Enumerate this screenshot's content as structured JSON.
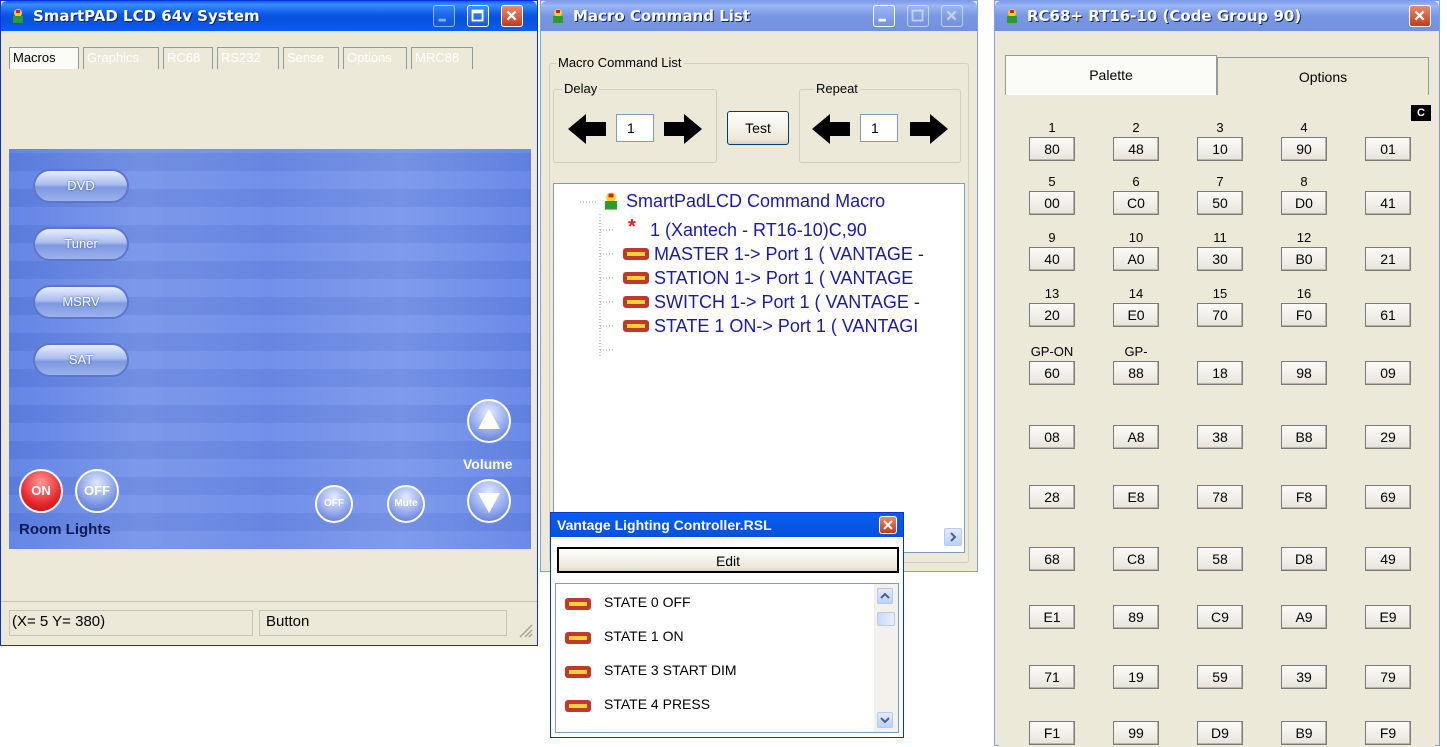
{
  "smartpad": {
    "title": "SmartPAD LCD 64v System",
    "tabs": [
      "Macros",
      "Graphics",
      "RC68",
      "RS232",
      "Sense",
      "Options",
      "MRC88"
    ],
    "buttons": [
      "DVD",
      "Tuner",
      "MSRV",
      "SAT"
    ],
    "lights_on": "ON",
    "lights_off": "OFF",
    "room_lights_label": "Room Lights",
    "volume_label": "Volume",
    "off_small": "OFF",
    "mute_small": "Mute",
    "status_coords": "(X= 5 Y= 380)",
    "status_type": "Button"
  },
  "macro": {
    "title": "Macro Command List",
    "group_label": "Macro Command List",
    "delay_label": "Delay",
    "delay_value": "1",
    "test_label": "Test",
    "repeat_label": "Repeat",
    "repeat_value": "1",
    "tree_root": "SmartPadLCD Command Macro",
    "tree_items": [
      "1 (Xantech - RT16-10)C,90",
      "MASTER 1-> Port 1 ( VANTAGE -",
      "STATION 1-> Port 1 ( VANTAGE",
      "SWITCH 1-> Port 1 ( VANTAGE -",
      "STATE 1 ON-> Port 1 ( VANTAGI"
    ]
  },
  "vantage": {
    "title": "Vantage Lighting Controller.RSL",
    "edit_label": "Edit",
    "items": [
      "STATE 0 OFF",
      "STATE 1 ON",
      "STATE 3 START DIM",
      "STATE 4 PRESS"
    ]
  },
  "rc68": {
    "title": "RC68+ RT16-10 (Code Group 90)",
    "tabs": [
      "Palette",
      "Options"
    ],
    "corner_badge": "C",
    "labels": [
      "1",
      "2",
      "3",
      "4",
      "5",
      "6",
      "7",
      "8",
      "9",
      "10",
      "11",
      "12",
      "13",
      "14",
      "15",
      "16",
      "GP-ON",
      "GP-OFF"
    ],
    "rows": [
      [
        "80",
        "48",
        "10",
        "90",
        "01"
      ],
      [
        "00",
        "C0",
        "50",
        "D0",
        "41"
      ],
      [
        "40",
        "A0",
        "30",
        "B0",
        "21"
      ],
      [
        "20",
        "E0",
        "70",
        "F0",
        "61"
      ],
      [
        "60",
        "88",
        "18",
        "98",
        "09"
      ],
      [
        "08",
        "A8",
        "38",
        "B8",
        "29"
      ],
      [
        "28",
        "E8",
        "78",
        "F8",
        "69"
      ],
      [
        "68",
        "C8",
        "58",
        "D8",
        "49"
      ],
      [
        "E1",
        "89",
        "C9",
        "A9",
        "E9"
      ],
      [
        "71",
        "19",
        "59",
        "39",
        "79"
      ],
      [
        "F1",
        "99",
        "D9",
        "B9",
        "F9"
      ]
    ]
  },
  "colors": {
    "title_active": "#0a5ef0",
    "title_inactive": "#7f9ce8",
    "tree_text": "#1a1aa6",
    "lights_on_red": "#e8282c",
    "panel_blue": "#6f8fe8"
  }
}
